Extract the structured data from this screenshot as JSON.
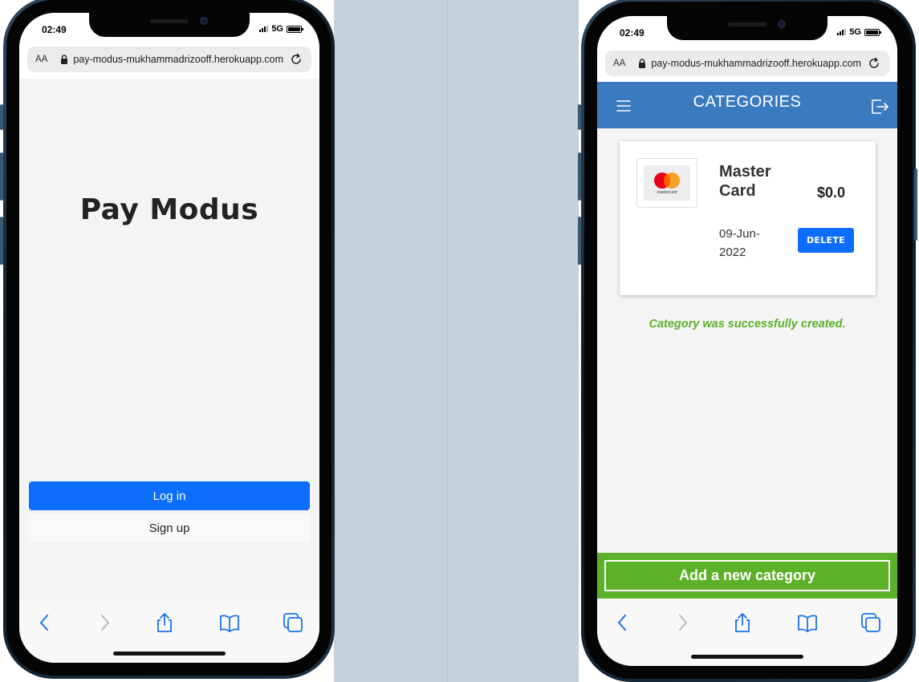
{
  "colors": {
    "background_left": "#ffffff",
    "background_mid": "#c4d0dc",
    "background_right": "#ffffff",
    "primary_blue": "#0d6efd",
    "header_blue": "#3a7abf",
    "success_green": "#5cb128"
  },
  "left_phone": {
    "status": {
      "time": "02:49",
      "network": "5G"
    },
    "browser": {
      "aa_label": "AA",
      "url": "pay-modus-mukhammadrizooff.herokuapp.com"
    },
    "app": {
      "title": "Pay Modus",
      "login_label": "Log in",
      "signup_label": "Sign up"
    },
    "toolbar_icons": [
      "back-icon",
      "forward-icon",
      "share-icon",
      "bookmarks-icon",
      "tabs-icon"
    ]
  },
  "right_phone": {
    "status": {
      "time": "02:49",
      "network": "5G"
    },
    "browser": {
      "aa_label": "AA",
      "url": "pay-modus-mukhammadrizooff.herokuapp.com"
    },
    "app": {
      "header_title": "CATEGORIES",
      "card": {
        "name": "Master Card",
        "amount": "$0.0",
        "date": "09-Jun-2022",
        "delete_label": "DELETE",
        "logo_text": "mastercard"
      },
      "flash_message": "Category was successfully created.",
      "add_label": "Add a new category"
    },
    "toolbar_icons": [
      "back-icon",
      "forward-icon",
      "share-icon",
      "bookmarks-icon",
      "tabs-icon"
    ]
  }
}
